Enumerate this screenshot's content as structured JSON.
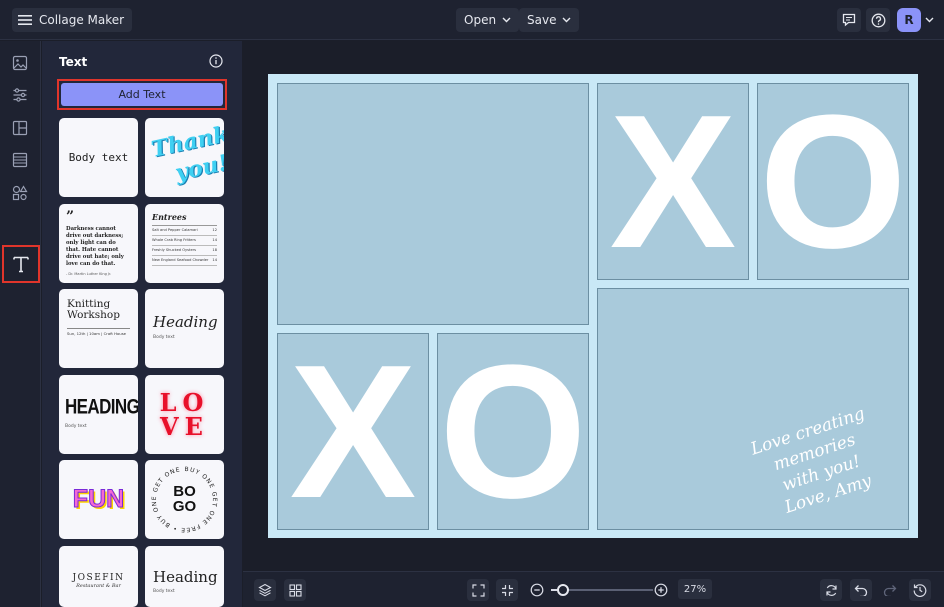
{
  "app": {
    "title": "Collage Maker"
  },
  "topbar": {
    "open_label": "Open",
    "save_label": "Save",
    "avatar_initial": "R"
  },
  "panel": {
    "title": "Text",
    "add_text_label": "Add Text",
    "tiles": [
      {
        "name": "body-text",
        "text": "Body text"
      },
      {
        "name": "thank-you",
        "line1": "Thank",
        "line2": "you!"
      },
      {
        "name": "quote",
        "mark": "”",
        "body": "Darkness cannot drive out darkness; only light can do that. Hate cannot drive out hate; only love can do that.",
        "author": "- Dr. Martin Luther King Jr."
      },
      {
        "name": "menu",
        "title": "Entrees",
        "items": [
          "Salt and Pepper Calamari",
          "Whole Crab Ring Fritters",
          "Freshly Shucked Oysters",
          "New England Seafood Chowder"
        ],
        "prices": [
          "12",
          "14",
          "18",
          "14"
        ]
      },
      {
        "name": "knitting",
        "line1": "Knitting",
        "line2": "Workshop",
        "meta": "Sun, 12th | 10am | Craft House"
      },
      {
        "name": "heading-serif",
        "heading": "Heading",
        "body": "Body text"
      },
      {
        "name": "heading-bold",
        "heading": "HEADING",
        "body": "Body text"
      },
      {
        "name": "love",
        "line1": "LO",
        "line2": "VE"
      },
      {
        "name": "fun",
        "text": "FUN"
      },
      {
        "name": "bogo",
        "line1": "BO",
        "line2": "GO",
        "ring": "BUY ONE GET ONE FREE • BUY ONE GET ONE FREE •"
      },
      {
        "name": "josefin",
        "line1": "JOSEFIN",
        "line2": "Restaurant & Bar"
      },
      {
        "name": "heading-serif-2",
        "heading": "Heading",
        "body": "Body text"
      }
    ]
  },
  "canvas": {
    "letters": [
      "X",
      "O",
      "X",
      "O"
    ],
    "script_lines": [
      "Love creating",
      "memories",
      "with you!",
      "Love, Amy"
    ],
    "bg_color": "#c9e8f6",
    "cell_color": "#a9cadb"
  },
  "bottombar": {
    "zoom": "27%",
    "zoom_fraction": 0.1
  },
  "colors": {
    "accent": "#8b93f8",
    "highlight": "#e0352b"
  }
}
